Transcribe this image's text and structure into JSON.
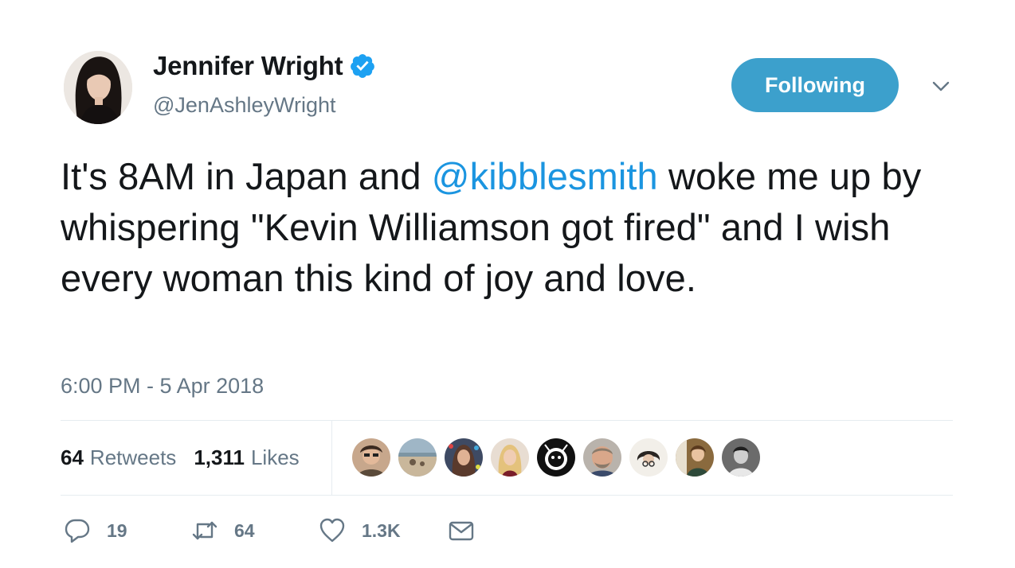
{
  "tweet": {
    "author": {
      "name": "Jennifer Wright",
      "handle": "@JenAshleyWright",
      "verified": true
    },
    "follow_button": "Following",
    "text_parts": {
      "before": "It's 8AM in Japan and ",
      "mention": "@kibblesmith",
      "after": " woke me up by whispering \"Kevin Williamson got fired\" and I wish every woman this kind of joy and love."
    },
    "timestamp": "6:00 PM - 5 Apr 2018",
    "stats": {
      "retweets_count": "64",
      "retweets_label": "Retweets",
      "likes_count": "1,311",
      "likes_label": "Likes"
    },
    "actions": {
      "replies": "19",
      "retweets": "64",
      "likes": "1.3K"
    }
  },
  "colors": {
    "accent": "#1b95e0",
    "follow_button": "#3ca0cc",
    "muted": "#657786",
    "text": "#14171a"
  },
  "icons": {
    "verified": "verified-badge-icon",
    "caret": "chevron-down-icon",
    "reply": "reply-icon",
    "retweet": "retweet-icon",
    "like": "heart-icon",
    "dm": "envelope-icon"
  }
}
